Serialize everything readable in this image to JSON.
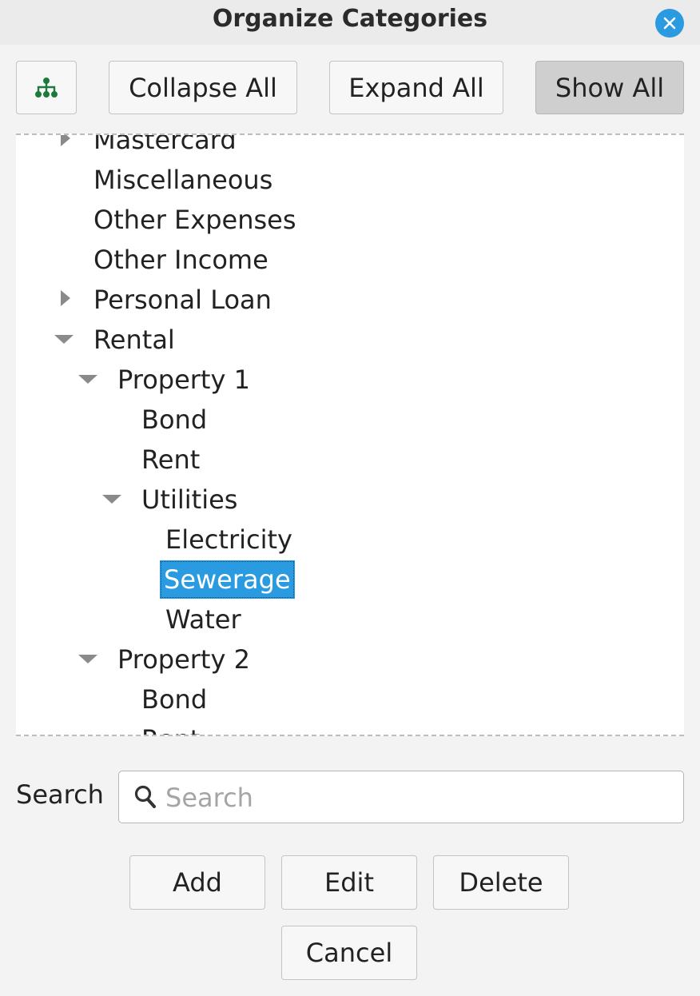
{
  "window": {
    "title": "Organize Categories"
  },
  "toolbar": {
    "hierarchy_icon": "hierarchy-icon",
    "collapse_all": "Collapse All",
    "expand_all": "Expand All",
    "show_all": "Show All"
  },
  "tree": {
    "items": [
      {
        "label": "Mastercard",
        "level": 0,
        "state": "collapsed"
      },
      {
        "label": "Miscellaneous",
        "level": 0,
        "state": "leaf"
      },
      {
        "label": "Other Expenses",
        "level": 0,
        "state": "leaf"
      },
      {
        "label": "Other Income",
        "level": 0,
        "state": "leaf"
      },
      {
        "label": "Personal Loan",
        "level": 0,
        "state": "collapsed"
      },
      {
        "label": "Rental",
        "level": 0,
        "state": "expanded"
      },
      {
        "label": "Property 1",
        "level": 1,
        "state": "expanded"
      },
      {
        "label": "Bond",
        "level": 2,
        "state": "leaf"
      },
      {
        "label": "Rent",
        "level": 2,
        "state": "leaf"
      },
      {
        "label": "Utilities",
        "level": 2,
        "state": "expanded"
      },
      {
        "label": "Electricity",
        "level": 3,
        "state": "leaf"
      },
      {
        "label": "Sewerage",
        "level": 3,
        "state": "leaf",
        "selected": true
      },
      {
        "label": "Water",
        "level": 3,
        "state": "leaf"
      },
      {
        "label": "Property 2",
        "level": 1,
        "state": "expanded"
      },
      {
        "label": "Bond",
        "level": 2,
        "state": "leaf"
      },
      {
        "label": "Rent",
        "level": 2,
        "state": "leaf"
      }
    ]
  },
  "search": {
    "label": "Search",
    "placeholder": "Search",
    "value": ""
  },
  "actions": {
    "add": "Add",
    "edit": "Edit",
    "delete": "Delete",
    "cancel": "Cancel"
  },
  "colors": {
    "accent": "#2a9be0",
    "hierarchy_icon": "#1e7a3c"
  }
}
